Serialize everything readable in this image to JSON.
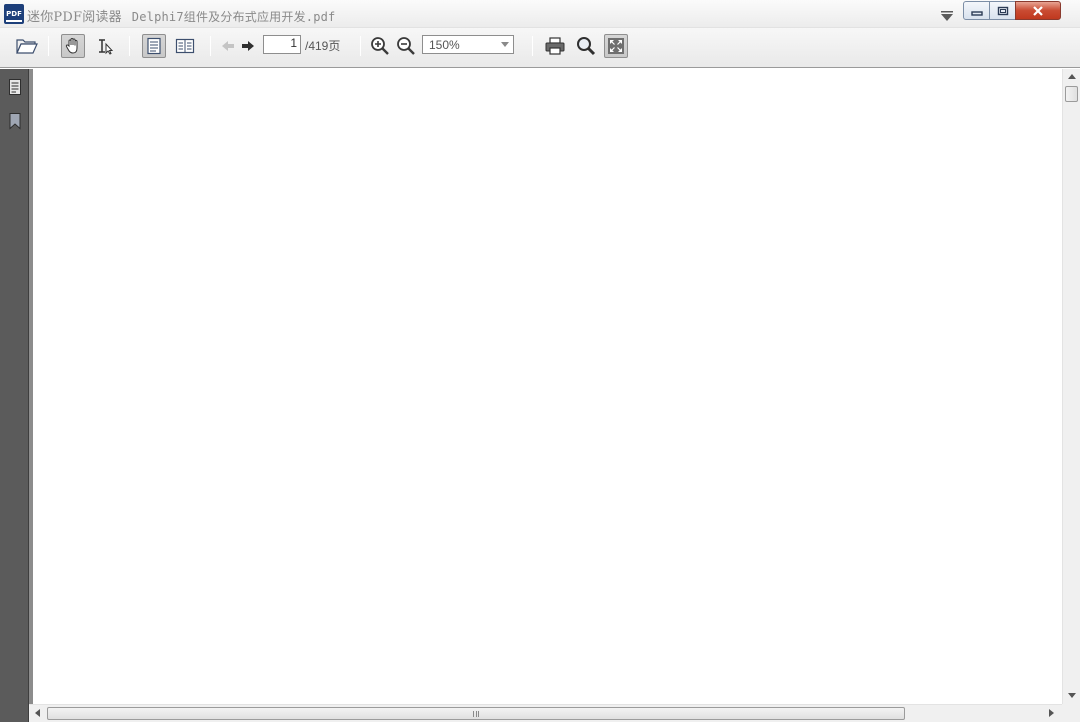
{
  "window": {
    "app_title": "迷你PDF阅读器",
    "document_title": "Delphi7组件及分布式应用开发.pdf",
    "logo_text": "PDF"
  },
  "toolbar": {
    "icons": [
      "open-folder-icon",
      "hand-tool-icon",
      "text-select-icon",
      "single-page-icon",
      "two-page-icon",
      "prev-page-icon",
      "next-page-icon",
      "zoom-in-icon",
      "zoom-out-icon",
      "print-icon",
      "search-icon",
      "fullscreen-icon"
    ],
    "current_page": "1",
    "page_total": "/419页",
    "zoom": "150%"
  },
  "sidebar": {
    "icons": [
      "page-thumbnails-icon",
      "bookmark-icon"
    ]
  },
  "colors": {
    "sidebar": "#5b5b5b",
    "close_button": "#c94b32",
    "toolbar": "#ececec"
  }
}
